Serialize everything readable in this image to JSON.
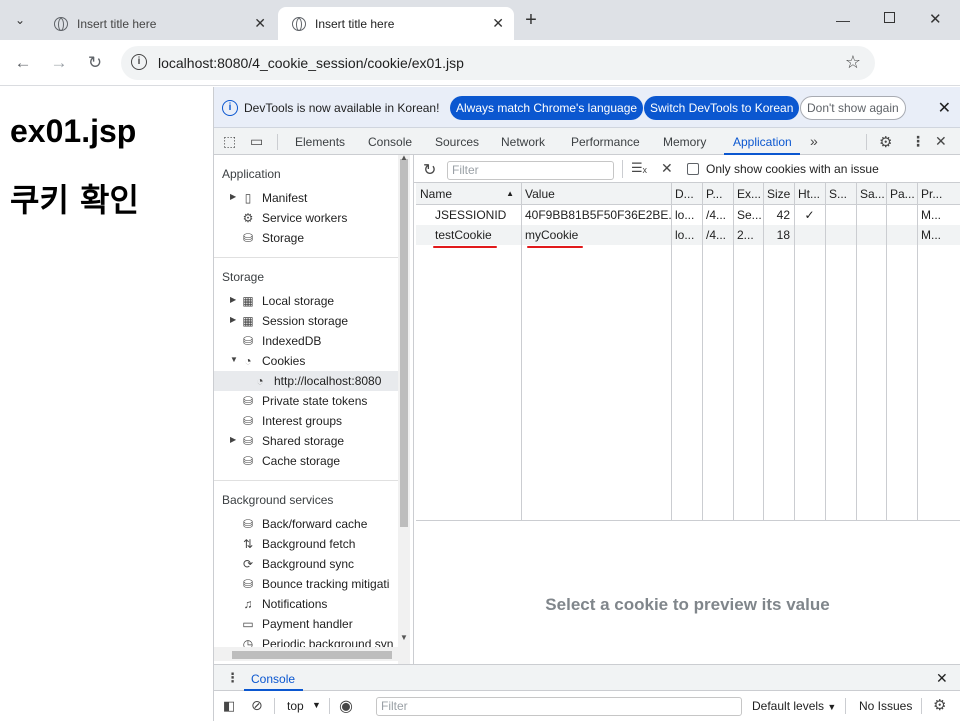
{
  "browser": {
    "tabs": [
      {
        "title": "Insert title here"
      },
      {
        "title": "Insert title here"
      }
    ],
    "url": "localhost:8080/4_cookie_session/cookie/ex01.jsp"
  },
  "page": {
    "title": "ex01.jsp",
    "subtitle": "쿠키 확인"
  },
  "devtools": {
    "infobar": {
      "message": "DevTools is now available in Korean!",
      "btn_match": "Always match Chrome's language",
      "btn_switch": "Switch DevTools to Korean",
      "btn_dismiss": "Don't show again"
    },
    "tabs": [
      "Elements",
      "Console",
      "Sources",
      "Network",
      "Performance",
      "Memory",
      "Application"
    ],
    "active_tab": "Application",
    "sidebar": {
      "application_header": "Application",
      "application_items": [
        "Manifest",
        "Service workers",
        "Storage"
      ],
      "storage_header": "Storage",
      "storage_items": [
        "Local storage",
        "Session storage",
        "IndexedDB",
        "Cookies",
        "http://localhost:8080",
        "Private state tokens",
        "Interest groups",
        "Shared storage",
        "Cache storage"
      ],
      "background_header": "Background services",
      "background_items": [
        "Back/forward cache",
        "Background fetch",
        "Background sync",
        "Bounce tracking mitigati",
        "Notifications",
        "Payment handler",
        "Periodic background syn"
      ]
    },
    "cookies": {
      "filter_placeholder": "Filter",
      "only_issue_label": "Only show cookies with an issue",
      "columns": [
        "Name",
        "Value",
        "D...",
        "P...",
        "Ex...",
        "Size",
        "Ht...",
        "S...",
        "Sa...",
        "Pa...",
        "Pr..."
      ],
      "rows": [
        [
          "JSESSIONID",
          "40F9BB81B5F50F36E2BE...",
          "lo...",
          "/4...",
          "Se...",
          "42",
          "✓",
          "",
          "",
          "",
          "M..."
        ],
        [
          "testCookie",
          "myCookie",
          "lo...",
          "/4...",
          "2...",
          "18",
          "",
          "",
          "",
          "",
          "M..."
        ]
      ],
      "preview_text": "Select a cookie to preview its value"
    },
    "drawer": {
      "tab": "Console",
      "context": "top",
      "filter_placeholder": "Filter",
      "levels": "Default levels",
      "issues": "No Issues"
    }
  }
}
